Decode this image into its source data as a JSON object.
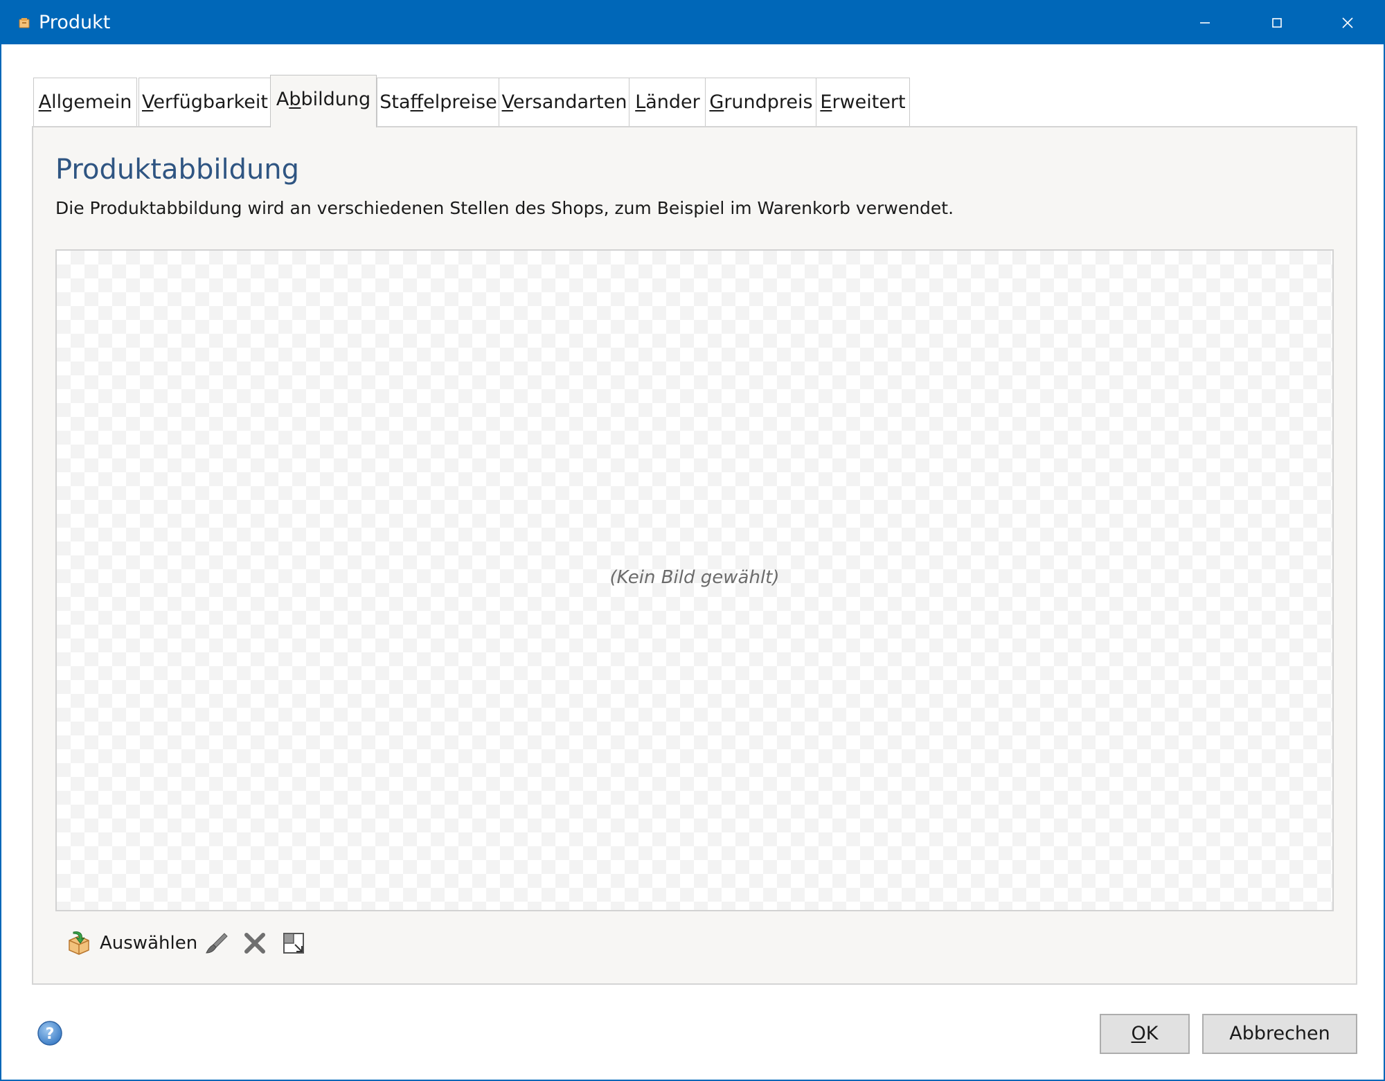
{
  "window": {
    "title": "Produkt",
    "accent_color": "#0067b8",
    "controls": [
      "minimize-icon",
      "maximize-icon",
      "close-icon"
    ]
  },
  "tabs": [
    {
      "key": "A",
      "rest": "llgemein",
      "pre": "",
      "label": "Allgemein"
    },
    {
      "pre": "",
      "key": "V",
      "rest": "erfügbarkeit",
      "label": "Verfügbarkeit"
    },
    {
      "pre": "A",
      "key": "b",
      "rest": "bildung",
      "label": "Abbildung",
      "active": true
    },
    {
      "pre": "Sta",
      "key": "f",
      "rest": "felpreise",
      "label": "Staffelpreise"
    },
    {
      "pre": "",
      "key": "V",
      "rest": "ersandarten",
      "label": "Versandarten"
    },
    {
      "pre": "",
      "key": "L",
      "rest": "änder",
      "label": "Länder"
    },
    {
      "pre": "",
      "key": "G",
      "rest": "rundpreis",
      "label": "Grundpreis"
    },
    {
      "pre": "",
      "key": "E",
      "rest": "rweitert",
      "label": "Erweitert"
    }
  ],
  "panel": {
    "heading": "Produktabbildung",
    "description": "Die Produktabbildung wird an verschiedenen Stellen des Shops, zum Beispiel im Warenkorb verwendet.",
    "heading_color": "#2f5582",
    "image_placeholder": "(Kein Bild gewählt)"
  },
  "image_toolbar": {
    "select_label": "Auswählen",
    "icons": [
      "folder-select-icon",
      "brush-edit-icon",
      "delete-icon",
      "resize-icon"
    ]
  },
  "footer": {
    "help_icon": "help-icon",
    "ok_key": "O",
    "ok_rest": "K",
    "ok_label": "OK",
    "cancel_label": "Abbrechen"
  }
}
